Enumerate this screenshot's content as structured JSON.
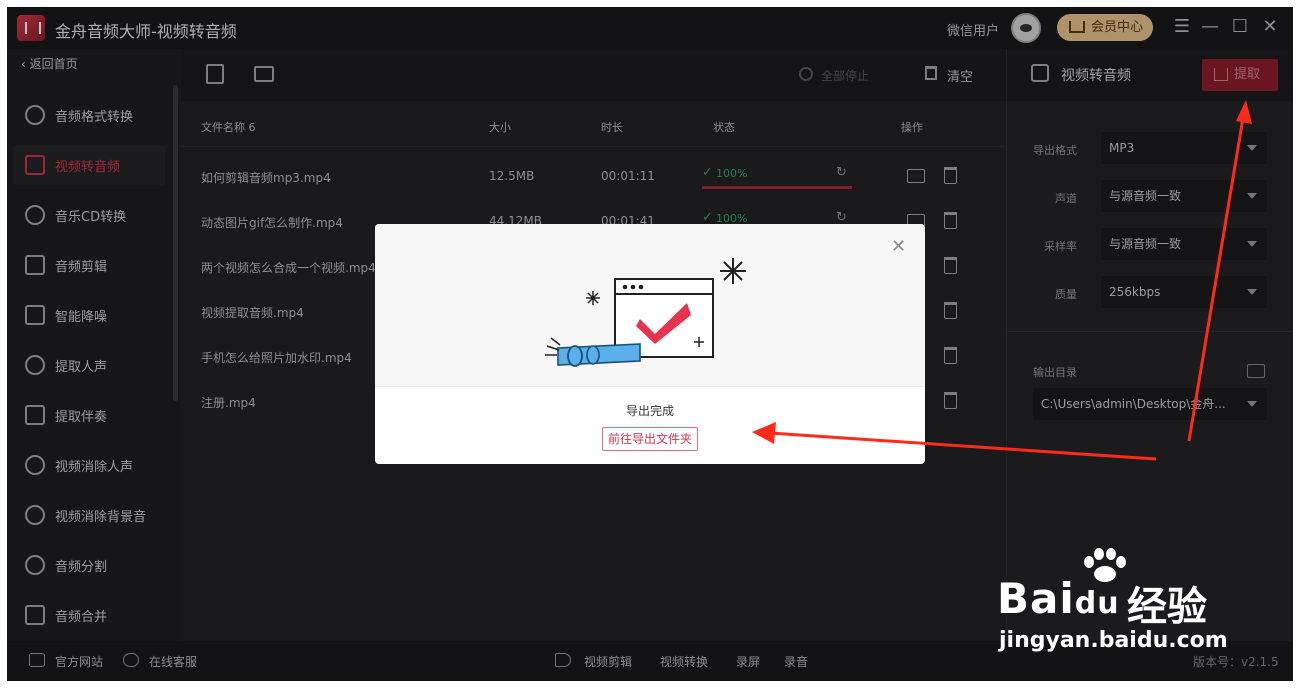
{
  "window": {
    "title": "金舟音频大师-视频转音频",
    "user_name": "微信用户",
    "vip_label": "会员中心"
  },
  "sidebar": {
    "back_label": "返回首页",
    "items": [
      {
        "label": "音频格式转换",
        "icon": "audio-convert-icon",
        "active": false
      },
      {
        "label": "视频转音频",
        "icon": "video-to-audio-icon",
        "active": true
      },
      {
        "label": "音乐CD转换",
        "icon": "cd-icon",
        "active": false
      },
      {
        "label": "音频剪辑",
        "icon": "audio-cut-icon",
        "active": false
      },
      {
        "label": "智能降噪",
        "icon": "denoise-icon",
        "active": false
      },
      {
        "label": "提取人声",
        "icon": "vocal-extract-icon",
        "active": false
      },
      {
        "label": "提取伴奏",
        "icon": "accompaniment-icon",
        "active": false
      },
      {
        "label": "视频消除人声",
        "icon": "remove-vocal-icon",
        "active": false
      },
      {
        "label": "视频消除背景音",
        "icon": "remove-bgm-icon",
        "active": false
      },
      {
        "label": "音频分割",
        "icon": "scissors-icon",
        "active": false
      },
      {
        "label": "音频合并",
        "icon": "merge-icon",
        "active": false
      }
    ]
  },
  "toolbar": {
    "stop_all_label": "全部停止",
    "clear_label": "清空"
  },
  "table": {
    "headers": {
      "name": "文件名称 6",
      "size": "大小",
      "duration": "时长",
      "status": "状态",
      "ops": "操作"
    },
    "rows": [
      {
        "name": "如何剪辑音频mp3.mp4",
        "size": "12.5MB",
        "duration": "00:01:11",
        "status": "100%"
      },
      {
        "name": "动态图片gif怎么制作.mp4",
        "size": "44.12MB",
        "duration": "00:01:41",
        "status": "100%"
      },
      {
        "name": "两个视频怎么合成一个视频.mp4",
        "size": "",
        "duration": "",
        "status": ""
      },
      {
        "name": "视频提取音频.mp4",
        "size": "",
        "duration": "",
        "status": ""
      },
      {
        "name": "手机怎么给照片加水印.mp4",
        "size": "",
        "duration": "",
        "status": ""
      },
      {
        "name": "注册.mp4",
        "size": "",
        "duration": "",
        "status": ""
      }
    ]
  },
  "right_panel": {
    "title": "视频转音频",
    "extract_label": "提取",
    "fields": [
      {
        "label": "导出格式",
        "value": "MP3"
      },
      {
        "label": "声道",
        "value": "与源音频一致"
      },
      {
        "label": "采样率",
        "value": "与源音频一致"
      },
      {
        "label": "质量",
        "value": "256kbps"
      }
    ],
    "output_label": "输出目录",
    "output_path": "C:\\Users\\admin\\Desktop\\金舟..."
  },
  "modal": {
    "message": "导出完成",
    "button_label": "前往导出文件夹"
  },
  "bottombar": {
    "website": "官方网站",
    "service": "在线客服",
    "links": [
      "视频剪辑",
      "视频转换",
      "录屏",
      "录音"
    ],
    "version": "版本号：v2.1.5"
  },
  "watermark": {
    "brand": "Bai",
    "brand2": "du",
    "jingyan": "经验",
    "url": "jingyan.baidu.com"
  },
  "colors": {
    "accent": "#d6344a",
    "success": "#2fae63",
    "background": "#1f1f22",
    "annotation_arrow": "#ff2a1a"
  }
}
